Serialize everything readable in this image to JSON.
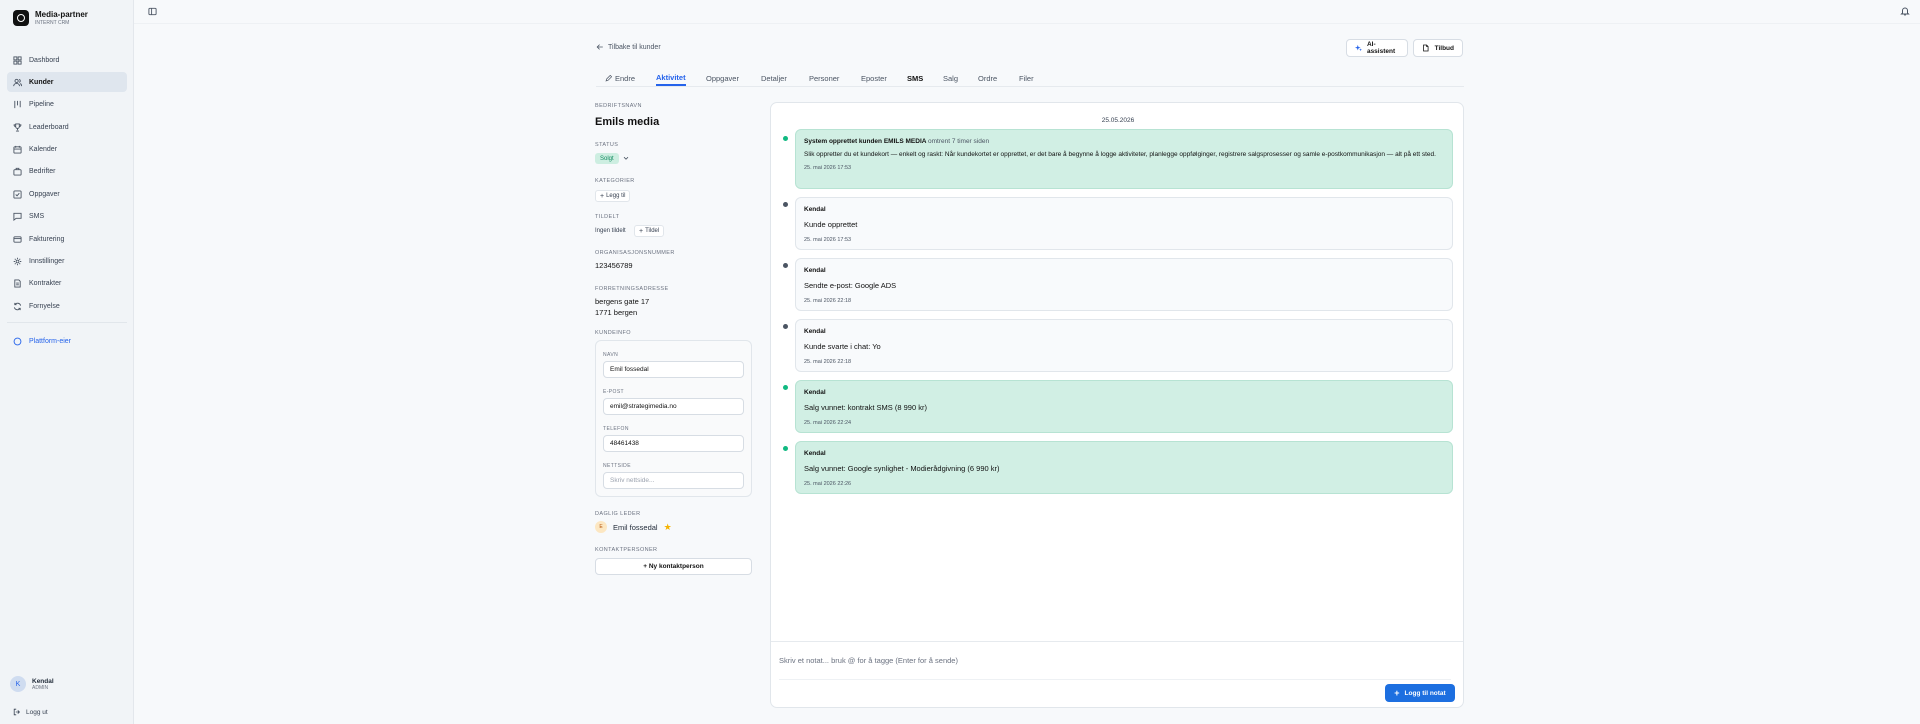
{
  "brand": {
    "name": "Media-partner",
    "subtitle": "INTERNT CRM"
  },
  "sidebar": {
    "items": [
      {
        "label": "Dashbord",
        "icon": "grid-icon"
      },
      {
        "label": "Kunder",
        "icon": "users-icon",
        "active": true
      },
      {
        "label": "Pipeline",
        "icon": "pipeline-icon"
      },
      {
        "label": "Leaderboard",
        "icon": "trophy-icon"
      },
      {
        "label": "Kalender",
        "icon": "calendar-icon"
      },
      {
        "label": "Bedrifter",
        "icon": "building-icon"
      },
      {
        "label": "Oppgaver",
        "icon": "check-square-icon"
      },
      {
        "label": "SMS",
        "icon": "message-icon"
      },
      {
        "label": "Fakturering",
        "icon": "invoice-icon"
      },
      {
        "label": "Innstillinger",
        "icon": "gear-icon"
      },
      {
        "label": "Kontrakter",
        "icon": "contract-icon"
      },
      {
        "label": "Fornyelse",
        "icon": "refresh-icon"
      }
    ],
    "platform": {
      "label": "Plattform-eier",
      "icon": "shield-icon"
    },
    "user": {
      "initial": "K",
      "name": "Kendal",
      "role": "ADMIN"
    },
    "logout": "Logg ut"
  },
  "header": {
    "back": "Tilbake til kunder",
    "ai_button": "AI-assistent",
    "offer_button": "Tilbud"
  },
  "tabs": [
    {
      "label": "Endre",
      "icon": "pencil-icon"
    },
    {
      "label": "Aktivitet",
      "active": true
    },
    {
      "label": "Oppgaver"
    },
    {
      "label": "Detaljer"
    },
    {
      "label": "Personer"
    },
    {
      "label": "Eposter"
    },
    {
      "label": "SMS",
      "bold": true
    },
    {
      "label": "Salg"
    },
    {
      "label": "Ordre"
    },
    {
      "label": "Filer"
    }
  ],
  "customer": {
    "company_label": "BEDRIFTSNAVN",
    "company_name": "Emils media",
    "status_label": "STATUS",
    "status_value": "Solgt",
    "categories_label": "KATEGORIER",
    "add_category": "Legg til",
    "assigned_label": "TILDELT",
    "assigned_value": "Ingen tildelt",
    "assign_button": "Tildel",
    "org_label": "ORGANISASJONSNUMMER",
    "org_value": "123456789",
    "address_label": "FORRETNINGSADRESSE",
    "address_line1": "bergens gate 17",
    "address_line2": "1771 bergen",
    "customer_info_label": "KUNDEINFO",
    "info": {
      "name_label": "NAVN",
      "name_value": "Emil fossedal",
      "email_label": "E-POST",
      "email_value": "emil@strategimedia.no",
      "phone_label": "TELEFON",
      "phone_value": "48461438",
      "website_label": "NETTSIDE",
      "website_placeholder": "Skriv nettside..."
    },
    "manager_label": "DAGLIG LEDER",
    "manager_initial": "E",
    "manager_name": "Emil fossedal",
    "contacts_label": "KONTAKTPERSONER",
    "new_contact": "+ Ny kontaktperson"
  },
  "activity": {
    "date": "25.05.2026",
    "items": [
      {
        "color": "green",
        "author": "System",
        "title_rest": "opprettet kunden EMILS MEDIA",
        "ago": "omtrent 7 timer siden",
        "text": "Slik oppretter du et kundekort — enkelt og raskt: Når kundekortet er opprettet, er det bare å begynne å logge aktiviteter, planlegge oppfølginger, registrere salgsprosesser og samle e-postkommunikasjon — alt på ett sted.",
        "time": "25. mai 2026 17:53"
      },
      {
        "color": "gray",
        "author": "Kendal",
        "text": "Kunde opprettet",
        "time": "25. mai 2026 17:53"
      },
      {
        "color": "gray",
        "author": "Kendal",
        "text": "Sendte e-post: Google ADS",
        "time": "25. mai 2026 22:18"
      },
      {
        "color": "gray",
        "author": "Kendal",
        "text": "Kunde svarte i chat: Yo",
        "time": "25. mai 2026 22:18"
      },
      {
        "color": "green",
        "author": "Kendal",
        "text": "Salg vunnet: kontrakt SMS (8 990 kr)",
        "time": "25. mai 2026 22:24"
      },
      {
        "color": "green",
        "author": "Kendal",
        "text": "Salg vunnet: Google synlighet - Modierådgivning (6 990 kr)",
        "time": "25. mai 2026 22:26"
      }
    ],
    "note_placeholder": "Skriv et notat... bruk @ for å tagge (Enter for å sende)",
    "send_button": "Logg til notat"
  }
}
